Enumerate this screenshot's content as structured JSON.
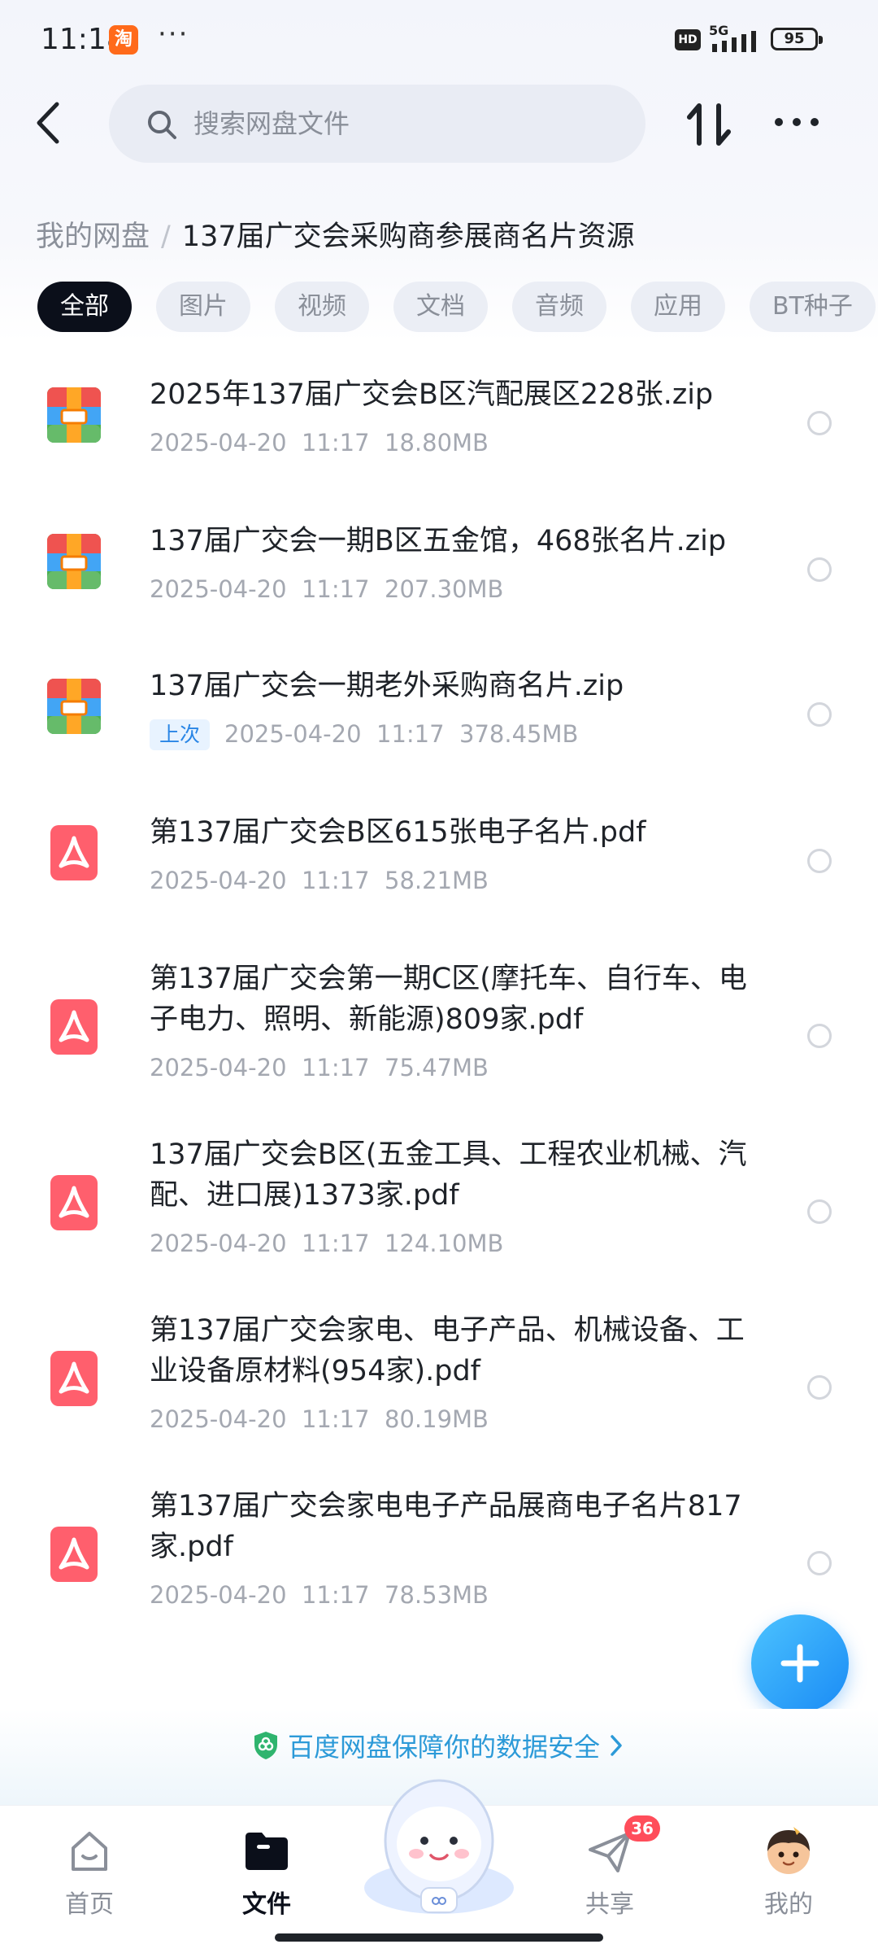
{
  "status_bar": {
    "time": "11:18",
    "taobao_icon_label": "淘",
    "more_dots": "···",
    "hd_label": "HD",
    "network": "5G",
    "battery": "95"
  },
  "header": {
    "search_placeholder": "搜索网盘文件"
  },
  "breadcrumb": {
    "root": "我的网盘",
    "separator": "/",
    "current": "137届广交会采购商参展商名片资源"
  },
  "tabs": [
    {
      "label": "全部",
      "active": true
    },
    {
      "label": "图片"
    },
    {
      "label": "视频"
    },
    {
      "label": "文档"
    },
    {
      "label": "音频"
    },
    {
      "label": "应用"
    },
    {
      "label": "BT种子"
    }
  ],
  "files": [
    {
      "name": "2025年137届广交会B区汽配展区228张.zip",
      "date": "2025-04-20",
      "time": "11:17",
      "size": "18.80MB",
      "type": "zip"
    },
    {
      "name": "137届广交会一期B区五金馆，468张名片.zip",
      "date": "2025-04-20",
      "time": "11:17",
      "size": "207.30MB",
      "type": "zip"
    },
    {
      "name": "137届广交会一期老外采购商名片.zip",
      "tag": "上次",
      "date": "2025-04-20",
      "time": "11:17",
      "size": "378.45MB",
      "type": "zip"
    },
    {
      "name": "第137届广交会B区615张电子名片.pdf",
      "date": "2025-04-20",
      "time": "11:17",
      "size": "58.21MB",
      "type": "pdf"
    },
    {
      "name": "第137届广交会第一期C区(摩托车、自行车、电子电力、照明、新能源)809家.pdf",
      "date": "2025-04-20",
      "time": "11:17",
      "size": "75.47MB",
      "type": "pdf"
    },
    {
      "name": "137届广交会B区(五金工具、工程农业机械、汽配、进口展)1373家.pdf",
      "date": "2025-04-20",
      "time": "11:17",
      "size": "124.10MB",
      "type": "pdf"
    },
    {
      "name": "第137届广交会家电、电子产品、机械设备、工业设备原材料(954家).pdf",
      "date": "2025-04-20",
      "time": "11:17",
      "size": "80.19MB",
      "type": "pdf"
    },
    {
      "name": "第137届广交会家电电子产品展商电子名片817家.pdf",
      "date": "2025-04-20",
      "time": "11:17",
      "size": "78.53MB",
      "type": "pdf"
    }
  ],
  "security_banner": {
    "text": "百度网盘保障你的数据安全"
  },
  "bottom_nav": {
    "home": "首页",
    "files": "文件",
    "share": "共享",
    "share_badge": "36",
    "mine": "我的"
  },
  "colors": {
    "accent": "#2a86e6",
    "active_tab": "#0b0f1a",
    "pdf_red": "#ff5f6d",
    "badge_red": "#ff4d5a"
  }
}
